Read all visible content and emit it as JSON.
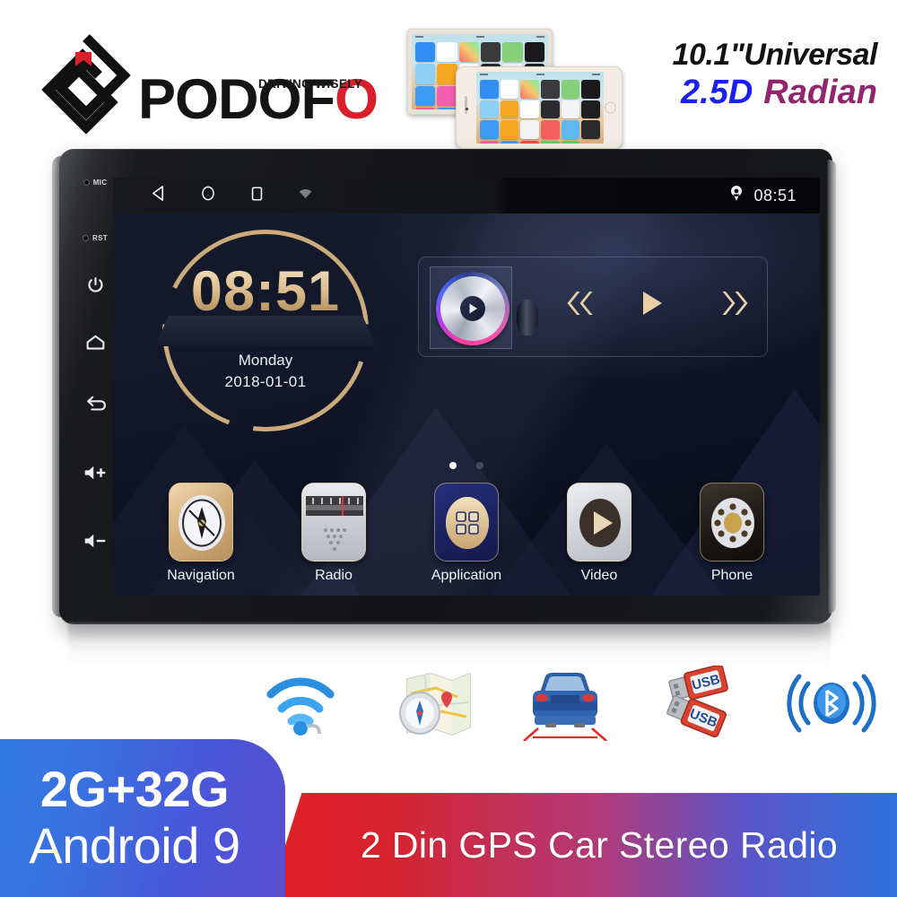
{
  "brand": {
    "name_part1": "PODOF",
    "name_last_letter": "O",
    "tagline": "DRIVING WISELY",
    "logo_icon": "podofo-diamond-logo",
    "accent_red": "#d81f2a",
    "ink": "#141414"
  },
  "headline": {
    "line1": "10.1\"Universal",
    "line2_highlight": "2.5D",
    "line2_rest": "Radian",
    "highlight_color": "#1a20f0",
    "rest_color": "#91266e"
  },
  "phone_mockups": {
    "caption": "iOS mirroring phones",
    "back_phone_icon": "iphone-landscape-back",
    "front_phone_icon": "iphone-landscape-front"
  },
  "device": {
    "bezel_controls": [
      {
        "icon": "mic-hole",
        "label": "MIC",
        "type": "pinhole"
      },
      {
        "icon": "reset-hole",
        "label": "RST",
        "type": "pinhole"
      },
      {
        "icon": "power-icon",
        "label": "",
        "type": "button"
      },
      {
        "icon": "home-icon",
        "label": "",
        "type": "button"
      },
      {
        "icon": "back-arrow-icon",
        "label": "",
        "type": "button"
      },
      {
        "icon": "volume-up-icon",
        "label": "",
        "type": "button"
      },
      {
        "icon": "volume-down-icon",
        "label": "",
        "type": "button"
      }
    ],
    "statusbar": {
      "nav_icons": [
        "back-triangle-icon",
        "home-circle-icon",
        "recents-square-icon",
        "wifi-icon"
      ],
      "location_icon": "location-pin-icon",
      "clock": "08:51"
    },
    "clock_widget": {
      "time": "08:51",
      "day": "Monday",
      "date": "2018-01-01",
      "accent_color": "#d9b887"
    },
    "media_widget": {
      "album_icon": "cd-disc-icon",
      "play_overlay_icon": "play-icon",
      "prev_icon": "previous-track-icon",
      "play_icon": "play-icon",
      "next_icon": "next-track-icon",
      "control_color": "#e8cfa6"
    },
    "page_dots": {
      "count": 2,
      "active_index": 0
    },
    "apps": [
      {
        "label": "Navigation",
        "icon": "compass-icon"
      },
      {
        "label": "Radio",
        "icon": "radio-dial-icon"
      },
      {
        "label": "Application",
        "icon": "app-grid-icon"
      },
      {
        "label": "Video",
        "icon": "play-icon"
      },
      {
        "label": "Phone",
        "icon": "phone-speaker-icon"
      }
    ]
  },
  "features": [
    {
      "icon": "wifi-icon",
      "label": "WiFi"
    },
    {
      "icon": "gps-map-compass-icon",
      "label": "GPS Navigation"
    },
    {
      "icon": "rear-view-camera-car-icon",
      "label": "Rear View Camera"
    },
    {
      "icon": "usb-drive-icon",
      "label": "USB"
    },
    {
      "icon": "bluetooth-icon",
      "label": "Bluetooth"
    }
  ],
  "banners": {
    "spec_line1": "2G+32G",
    "spec_line2": "Android 9",
    "product_title": "2 Din GPS Car Stereo Radio",
    "blue_color": "#3a6fe0",
    "red_color": "#e01f26"
  }
}
